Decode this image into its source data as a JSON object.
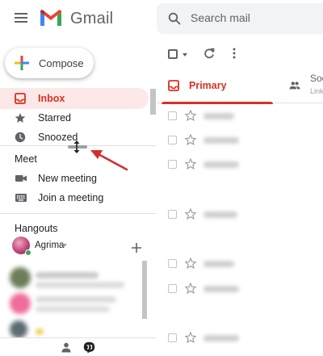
{
  "app": {
    "name": "Gmail",
    "colors": {
      "accent_red": "#d93025",
      "active_bg": "#fce8e6",
      "icon_gray": "#5f6368"
    }
  },
  "search": {
    "placeholder": "Search mail"
  },
  "compose": {
    "label": "Compose"
  },
  "sidebar": {
    "items": [
      {
        "label": "Inbox",
        "icon": "inbox-icon",
        "active": true
      },
      {
        "label": "Starred",
        "icon": "star-icon",
        "active": false
      },
      {
        "label": "Snoozed",
        "icon": "clock-icon",
        "active": false
      }
    ]
  },
  "meet": {
    "title": "Meet",
    "items": [
      {
        "label": "New meeting",
        "icon": "videocam-icon"
      },
      {
        "label": "Join a meeting",
        "icon": "keyboard-icon"
      }
    ]
  },
  "hangouts": {
    "title": "Hangouts",
    "user": "Agrima"
  },
  "tabs": [
    {
      "label": "Primary",
      "icon": "inbox-icon",
      "active": true
    },
    {
      "label": "Social",
      "sub": "LinkedIn",
      "icon": "people-icon",
      "active": false
    }
  ]
}
